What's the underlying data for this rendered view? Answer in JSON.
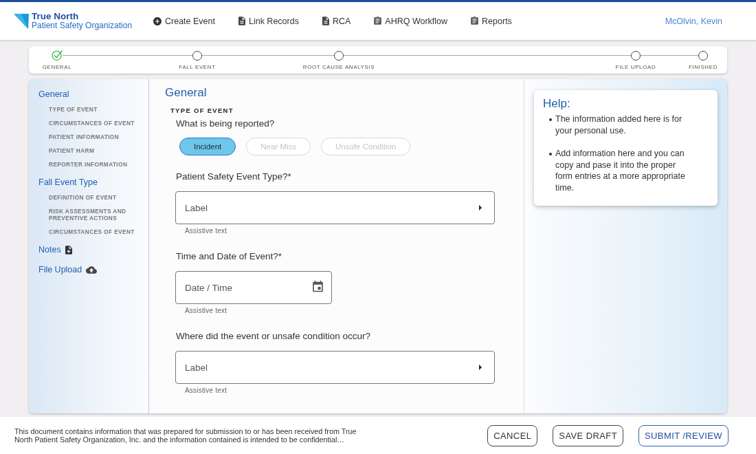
{
  "header": {
    "logo": {
      "title": "True North",
      "subtitle": "Patient Safety Organization"
    },
    "nav": [
      {
        "label": "Create Event"
      },
      {
        "label": "Link Records"
      },
      {
        "label": "RCA"
      },
      {
        "label": "AHRQ Workflow"
      },
      {
        "label": "Reports"
      }
    ],
    "user": "McOlvin, Kevin"
  },
  "stepper": [
    {
      "label": "GENERAL",
      "completed": true
    },
    {
      "label": "FALL EVENT",
      "completed": false
    },
    {
      "label": "ROOT CAUSE ANALYSIS",
      "completed": false
    },
    {
      "label": "FILE UPLOAD",
      "completed": false
    },
    {
      "label": "FINISHED",
      "completed": false
    }
  ],
  "sidebar": {
    "items": [
      {
        "label": "General",
        "kind": "group",
        "children": [
          {
            "label": "TYPE OF EVENT"
          },
          {
            "label": "CIRCUMSTANCES OF EVENT"
          },
          {
            "label": "PATIENT INFORMATION"
          },
          {
            "label": "PATIENT HARM"
          },
          {
            "label": "REPORTER INFORMATION"
          }
        ]
      },
      {
        "label": "Fall Event Type",
        "kind": "group",
        "children": [
          {
            "label": "DEFINITION OF EVENT"
          },
          {
            "label": "RISK ASSESSMENTS AND PREVENTIVE ACTIONS"
          },
          {
            "label": "CIRCUMSTANCES OF EVENT"
          }
        ]
      },
      {
        "label": "Notes",
        "kind": "notes"
      },
      {
        "label": "File Upload",
        "kind": "upload"
      }
    ]
  },
  "form": {
    "title": "General",
    "section": "TYPE OF EVENT",
    "reported": {
      "question": "What is being reported?",
      "options": [
        {
          "label": "Incident",
          "selected": true
        },
        {
          "label": "Near Miss",
          "selected": false
        },
        {
          "label": "Unsafe Condition",
          "selected": false
        }
      ]
    },
    "fields": [
      {
        "kind": "select",
        "label": "Patient Safety Event Type?*",
        "placeholder": "Label",
        "helper": "Assistive text"
      },
      {
        "kind": "date",
        "label": "Time and Date of Event?*",
        "placeholder": "Date / Time",
        "helper": "Assistive text"
      },
      {
        "kind": "select",
        "label": "Where did the event or unsafe condition occur?",
        "placeholder": "Label",
        "helper": "Assistive text"
      }
    ]
  },
  "help": {
    "title": "Help:",
    "items": [
      "The information added here is for your personal use.",
      "Add information here and you can copy and pase it into the proper form entries at a more appropriate time."
    ]
  },
  "footer": {
    "disclaimer": "This document contains information that was prepared for submission to or has been received from True North Patient Safety Organization, Inc. and the information contained is intended to be confidential…",
    "buttons": [
      {
        "label": "CANCEL",
        "kind": "secondary"
      },
      {
        "label": "SAVE DRAFT",
        "kind": "secondary"
      },
      {
        "label": "SUBMIT /REVIEW",
        "kind": "primary"
      }
    ]
  }
}
